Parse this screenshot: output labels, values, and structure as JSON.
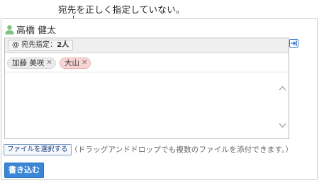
{
  "annotation": {
    "text": "宛先を正しく指定していない。"
  },
  "user": {
    "name": "高橋 健太",
    "icon": "user-icon"
  },
  "specify": {
    "prefix": "@ 宛先指定：",
    "count": "2人"
  },
  "recipients": [
    {
      "name": "加藤 美咲",
      "state": "normal",
      "remove_icon": "close-icon"
    },
    {
      "name": "大山",
      "state": "alert",
      "remove_icon": "close-icon"
    }
  ],
  "editor": {
    "body": ""
  },
  "attach": {
    "button_label": "ファイルを選択する",
    "hint": "（ドラッグアンドドロップでも複数のファイルを添付できます。）"
  },
  "submit": {
    "label": "書き込む"
  },
  "colors": {
    "accent": "#3a87d8",
    "alert_chip": "#f8d5d5",
    "annotation_line": "#d0021b",
    "user_icon": "#7bc67e"
  }
}
